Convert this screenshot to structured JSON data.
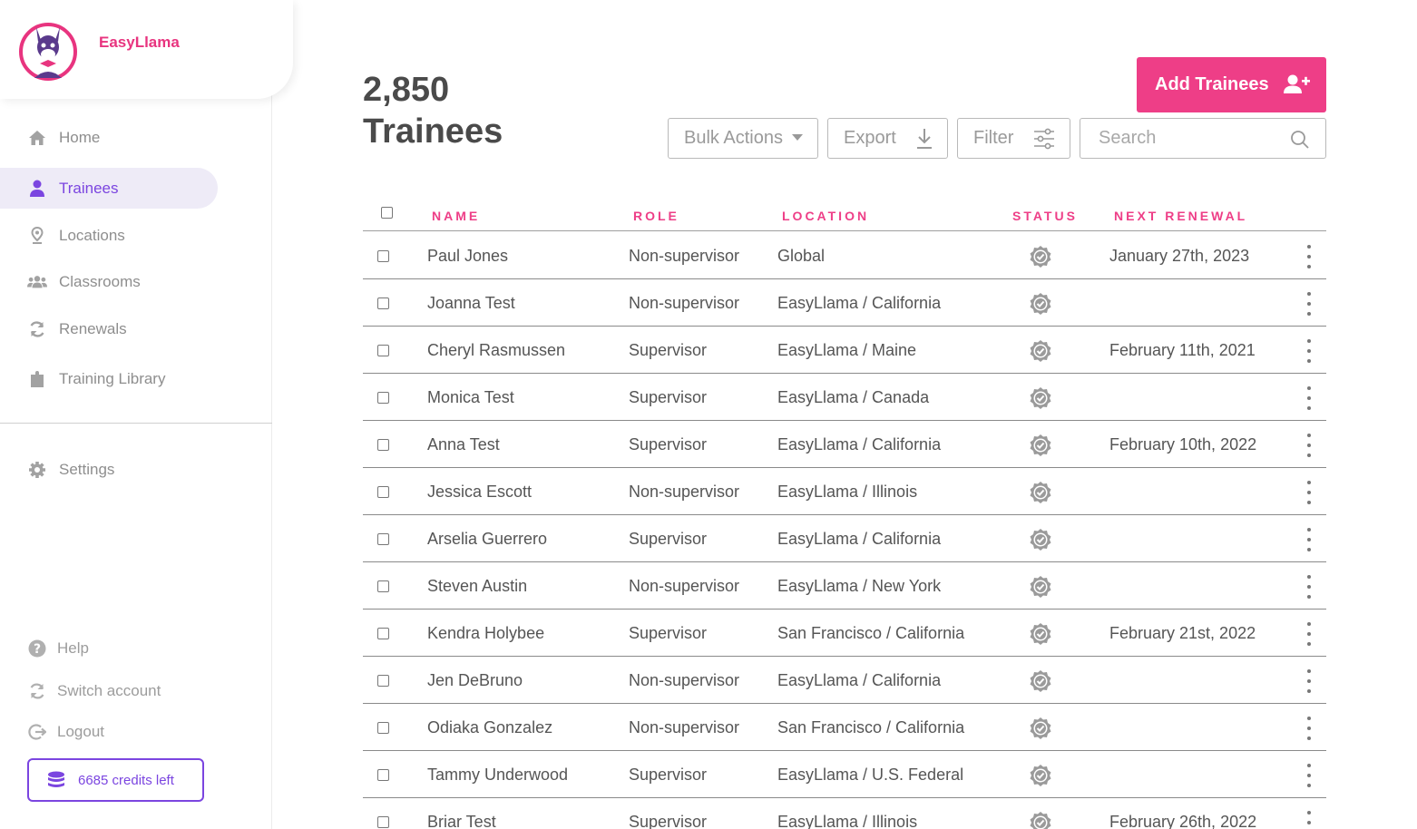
{
  "brand": {
    "name": "EasyLlama"
  },
  "nav": [
    {
      "label": "Home",
      "icon": "home-icon"
    },
    {
      "label": "Trainees",
      "icon": "user-icon",
      "active": true
    },
    {
      "label": "Locations",
      "icon": "location-pin-icon"
    },
    {
      "label": "Classrooms",
      "icon": "users-group-icon"
    },
    {
      "label": "Renewals",
      "icon": "refresh-icon"
    },
    {
      "label": "Training Library",
      "icon": "puzzle-icon"
    }
  ],
  "settings": {
    "label": "Settings",
    "icon": "gear-icon"
  },
  "footer": {
    "help": "Help",
    "switch_account": "Switch account",
    "logout": "Logout",
    "credits": "6685 credits left"
  },
  "page": {
    "count": "2,850",
    "title": "Trainees"
  },
  "toolbar": {
    "add_trainees": "Add Trainees",
    "bulk_actions": "Bulk Actions",
    "export": "Export",
    "filter": "Filter",
    "search_placeholder": "Search"
  },
  "table": {
    "columns": [
      "NAME",
      "ROLE",
      "LOCATION",
      "STATUS",
      "NEXT RENEWAL"
    ],
    "rows": [
      {
        "name": "Paul Jones",
        "role": "Non-supervisor",
        "location": "Global",
        "renewal": "January 27th, 2023"
      },
      {
        "name": "Joanna Test",
        "role": "Non-supervisor",
        "location": "EasyLlama / California",
        "renewal": ""
      },
      {
        "name": "Cheryl Rasmussen",
        "role": "Supervisor",
        "location": "EasyLlama / Maine",
        "renewal": "February 11th, 2021"
      },
      {
        "name": "Monica Test",
        "role": "Supervisor",
        "location": "EasyLlama / Canada",
        "renewal": ""
      },
      {
        "name": "Anna Test",
        "role": "Supervisor",
        "location": "EasyLlama / California",
        "renewal": "February 10th, 2022"
      },
      {
        "name": "Jessica Escott",
        "role": "Non-supervisor",
        "location": "EasyLlama / Illinois",
        "renewal": ""
      },
      {
        "name": "Arselia Guerrero",
        "role": "Supervisor",
        "location": "EasyLlama / California",
        "renewal": ""
      },
      {
        "name": "Steven Austin",
        "role": "Non-supervisor",
        "location": "EasyLlama / New York",
        "renewal": ""
      },
      {
        "name": "Kendra Holybee",
        "role": "Supervisor",
        "location": "San Francisco / California",
        "renewal": "February 21st, 2022"
      },
      {
        "name": "Jen DeBruno",
        "role": "Non-supervisor",
        "location": "EasyLlama / California",
        "renewal": ""
      },
      {
        "name": "Odiaka Gonzalez",
        "role": "Non-supervisor",
        "location": "San Francisco / California",
        "renewal": ""
      },
      {
        "name": "Tammy Underwood",
        "role": "Supervisor",
        "location": "EasyLlama / U.S. Federal",
        "renewal": ""
      },
      {
        "name": "Briar Test",
        "role": "Supervisor",
        "location": "EasyLlama / Illinois",
        "renewal": "February 26th, 2022"
      }
    ]
  },
  "colors": {
    "accent_pink": "#ee3e87",
    "accent_purple": "#7b45e0",
    "nav_active_bg": "#eeebf7",
    "status_badge": "#9a9a9a"
  }
}
